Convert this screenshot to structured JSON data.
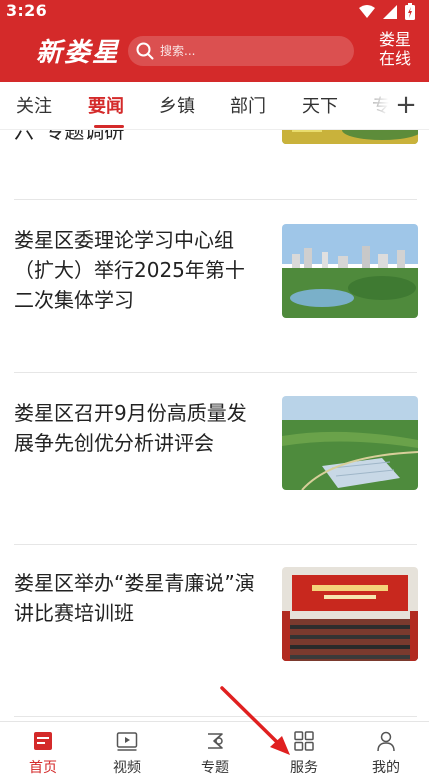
{
  "status": {
    "time": "3:26"
  },
  "header": {
    "logo_text": "新娄星",
    "search_placeholder": "搜索...",
    "region_line1": "娄星",
    "region_line2": "在线",
    "accent_color": "#d42a2a"
  },
  "tabs": [
    {
      "label": "关注"
    },
    {
      "label": "要闻"
    },
    {
      "label": "乡镇"
    },
    {
      "label": "部门"
    },
    {
      "label": "天下"
    },
    {
      "label": "专"
    }
  ],
  "tabs_more": "+",
  "articles": [
    {
      "title": "六”专题调研"
    },
    {
      "title": "娄星区委理论学习中心组（扩大）举行2025年第十二次集体学习"
    },
    {
      "title": "娄星区召开9月份高质量发展争先创优分析讲评会"
    },
    {
      "title": "娄星区举办“娄星青廉说”演讲比赛培训班"
    }
  ],
  "bottom_nav": [
    {
      "label": "首页",
      "icon": "home-icon"
    },
    {
      "label": "视频",
      "icon": "video-icon"
    },
    {
      "label": "专题",
      "icon": "topic-icon"
    },
    {
      "label": "服务",
      "icon": "grid-icon"
    },
    {
      "label": "我的",
      "icon": "person-icon"
    }
  ]
}
